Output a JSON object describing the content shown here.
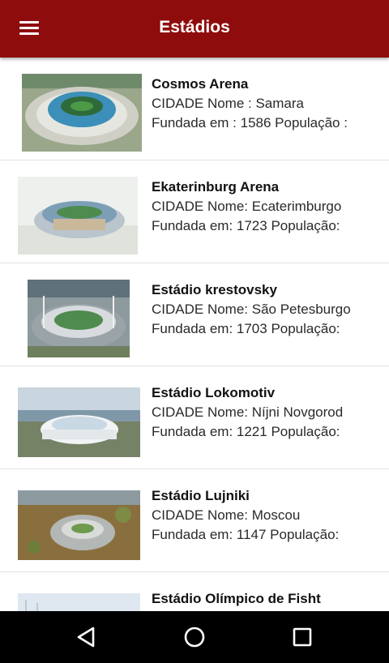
{
  "appbar": {
    "title": "Estádios",
    "menu_icon": "menu-icon",
    "background": "#8e0c0c"
  },
  "stadiums": [
    {
      "name": "Cosmos Arena",
      "city_line": "CIDADE Nome : Samara",
      "founded_line": "Fundada em : 1586 População :"
    },
    {
      "name": "Ekaterinburg Arena",
      "city_line": "CIDADE Nome:   Ecaterimburgo",
      "founded_line": "Fundada em: 1723 População:"
    },
    {
      "name": "Estádio krestovsky",
      "city_line": "CIDADE Nome: São Petesburgo",
      "founded_line": "Fundada em: 1703 População:"
    },
    {
      "name": "Estádio Lokomotiv",
      "city_line": "CIDADE Nome:  Níjni Novgorod",
      "founded_line": "Fundada em: 1221 População:"
    },
    {
      "name": "Estádio Lujniki",
      "city_line": "CIDADE Nome: Moscou",
      "founded_line": "Fundada em: 1147 População:"
    },
    {
      "name": "Estádio Olímpico de Fisht",
      "city_line": "",
      "founded_line": ""
    }
  ],
  "navbar": {
    "back_icon": "back-icon",
    "home_icon": "home-icon",
    "recents_icon": "recents-icon"
  }
}
